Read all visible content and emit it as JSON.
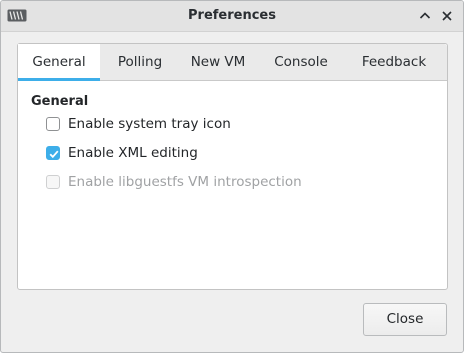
{
  "window": {
    "title": "Preferences"
  },
  "tabs": [
    {
      "label": "General",
      "active": true
    },
    {
      "label": "Polling",
      "active": false
    },
    {
      "label": "New VM",
      "active": false
    },
    {
      "label": "Console",
      "active": false
    },
    {
      "label": "Feedback",
      "active": false
    }
  ],
  "general": {
    "section_title": "General",
    "options": [
      {
        "label": "Enable system tray icon",
        "checked": false,
        "enabled": true
      },
      {
        "label": "Enable XML editing",
        "checked": true,
        "enabled": true
      },
      {
        "label": "Enable libguestfs VM introspection",
        "checked": false,
        "enabled": false
      }
    ]
  },
  "buttons": {
    "close_label": "Close"
  },
  "icons": {
    "app": "virt-manager-app-icon",
    "minimize": "chevron-up-icon",
    "close": "close-icon"
  },
  "colors": {
    "accent": "#3daee9",
    "window_bg": "#efefef",
    "titlebar_bg": "#e3e3e3",
    "disabled_text": "#a0a2a4"
  }
}
